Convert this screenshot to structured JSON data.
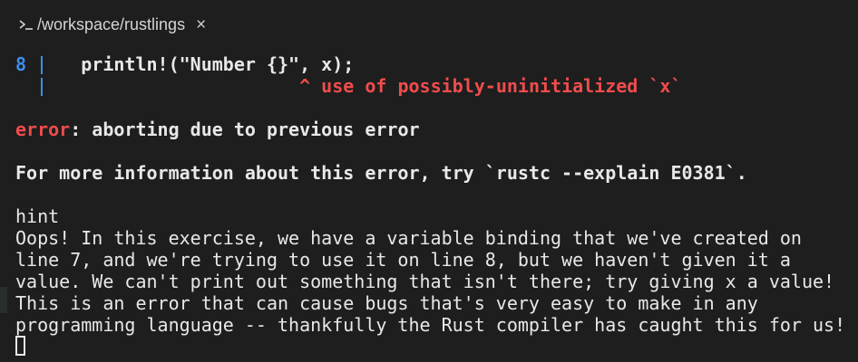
{
  "tab": {
    "title": "/workspace/rustlings",
    "icon": "terminal-icon",
    "close_icon": "close-icon"
  },
  "terminal": {
    "code_line_number": "8",
    "code_bar": "|",
    "code_text": "    println!(\"Number {}\", x);",
    "caret_text": "^ use of possibly-uninitialized `x`",
    "error_label": "error",
    "error_text": ": aborting due to previous error",
    "more_info": "For more information about this error, try `rustc --explain E0381`.",
    "hint_label": "hint",
    "hint_lines": [
      "Oops! In this exercise, we have a variable binding that we've created on",
      "line 7, and we're trying to use it on line 8, but we haven't given it a",
      "value. We can't print out something that isn't there; try giving x a value!",
      "This is an error that can cause bugs that's very easy to make in any",
      "programming language -- thankfully the Rust compiler has caught this for us!"
    ]
  },
  "colors": {
    "background": "#1e1e1e",
    "line_number": "#3b8eea",
    "error": "#f14c4c",
    "text": "#e8e8e8"
  }
}
